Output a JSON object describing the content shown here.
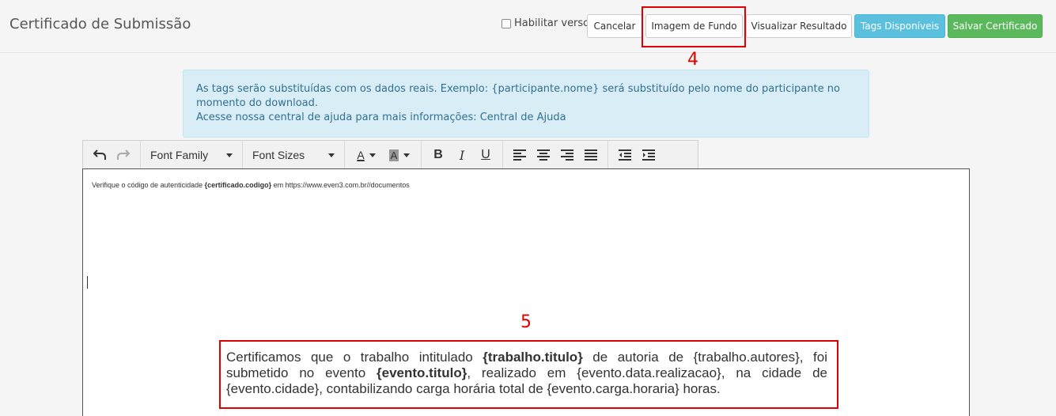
{
  "header": {
    "title": "Certificado de Submissão",
    "verso_label": "Habilitar verso",
    "buttons": {
      "cancel": "Cancelar",
      "background": "Imagem de Fundo",
      "preview": "Visualizar Resultado",
      "tags": "Tags Disponíveis",
      "save": "Salvar Certificado"
    }
  },
  "markers": {
    "m4": "4",
    "m5": "5"
  },
  "alert": {
    "line1": "As tags serão substituídas com os dados reais. Exemplo: {participante.nome} será substituído pelo nome do participante no momento do download.",
    "line2_prefix": "Acesse nossa central de ajuda para mais informações: ",
    "line2_link": "Central de Ajuda"
  },
  "toolbar": {
    "font_family": "Font Family",
    "font_sizes": "Font Sizes"
  },
  "editor": {
    "verify_prefix": "Verifique o código de autenticidade ",
    "verify_tag": "{certificado.codigo}",
    "verify_suffix": " em https://www.even3.com.br//documentos",
    "cert": {
      "p1": "Certificamos que o trabalho intitulado ",
      "b1": "{trabalho.titulo}",
      "p2": " de autoria de {trabalho.autores}, foi submetido no evento ",
      "b2": "{evento.titulo}",
      "p3": ", realizado em {evento.data.realizacao}, na cidade de {evento.cidade}, contabilizando carga horária total de {evento.carga.horaria} horas."
    }
  },
  "colors": {
    "highlight": "#e00000",
    "info": "#5bc0de",
    "success": "#5cb85c"
  }
}
